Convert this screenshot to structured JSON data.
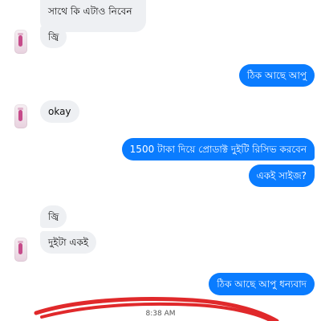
{
  "messages": [
    {
      "side": "in",
      "text": "সাথে কি এটাও নিবেন"
    },
    {
      "side": "in",
      "text": "জ্বি"
    },
    {
      "side": "out",
      "text": "ঠিক আছে আপু"
    },
    {
      "side": "in",
      "text": "okay"
    },
    {
      "side": "out",
      "text": "1500 টাকা দিয়ে প্রোডাক্ট দুইটি রিসিভ করবেন"
    },
    {
      "side": "out",
      "text": "একই সাইজ?"
    },
    {
      "side": "in",
      "text": "জ্বি"
    },
    {
      "side": "in",
      "text": "দুইটা একই"
    },
    {
      "side": "out",
      "text": "ঠিক আছে আপু ধন্যবাদ"
    }
  ],
  "timestamp": "8:38 AM",
  "colors": {
    "outgoing": "#0a7cff",
    "incoming": "#eef0f3",
    "annotation": "#e0292b"
  }
}
